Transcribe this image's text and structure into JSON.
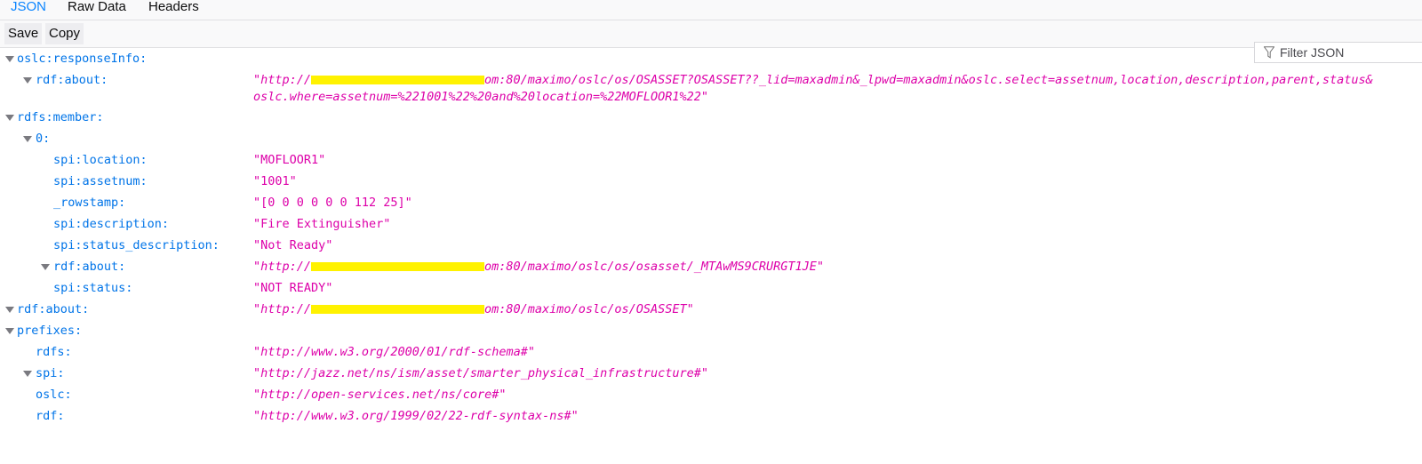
{
  "tabs": [
    "JSON",
    "Raw Data",
    "Headers"
  ],
  "toolbar": {
    "save_label": "Save",
    "copy_label": "Copy",
    "filter_placeholder": "Filter JSON"
  },
  "colors": {
    "key": "#0074e8",
    "string": "#dd00a9",
    "active_tab": "#0a84ff",
    "redaction": "#fff200"
  },
  "icons": {
    "filter": "funnel-icon",
    "twisty": "triangle-down-icon"
  },
  "rows": {
    "r1_key": "oslc:responseInfo:",
    "r2_key": "rdf:about:",
    "r2_val_a": "\"http://",
    "r2_val_b": "om:80/maximo/oslc/os/OSASSET?OSASSET??_lid=maxadmin&_lpwd=maxadmin&oslc.select=assetnum,location,description,parent,status&",
    "r2_val_line2": "oslc.where=assetnum=%221001%22%20and%20location=%22MOFLOOR1%22\"",
    "r3_key": "rdfs:member:",
    "r4_key": "0:",
    "r5_key": "spi:location:",
    "r5_val": "\"MOFLOOR1\"",
    "r6_key": "spi:assetnum:",
    "r6_val": "\"1001\"",
    "r7_key": "_rowstamp:",
    "r7_val": "\"[0 0 0 0 0 0 112 25]\"",
    "r8_key": "spi:description:",
    "r8_val": "\"Fire Extinguisher\"",
    "r9_key": "spi:status_description:",
    "r9_val": "\"Not Ready\"",
    "r10_key": "rdf:about:",
    "r10_val_a": "\"http://",
    "r10_val_b": "om:80/maximo/oslc/os/osasset/_MTAwMS9CRURGT1JE\"",
    "r11_key": "spi:status:",
    "r11_val": "\"NOT READY\"",
    "r12_key": "rdf:about:",
    "r12_val_a": "\"http://",
    "r12_val_b": "om:80/maximo/oslc/os/OSASSET\"",
    "r13_key": "prefixes:",
    "r14_key": "rdfs:",
    "r14_val": "\"http://www.w3.org/2000/01/rdf-schema#\"",
    "r15_key": "spi:",
    "r15_val": "\"http://jazz.net/ns/ism/asset/smarter_physical_infrastructure#\"",
    "r16_key": "oslc:",
    "r16_val": "\"http://open-services.net/ns/core#\"",
    "r17_key": "rdf:",
    "r17_val": "\"http://www.w3.org/1999/02/22-rdf-syntax-ns#\""
  }
}
